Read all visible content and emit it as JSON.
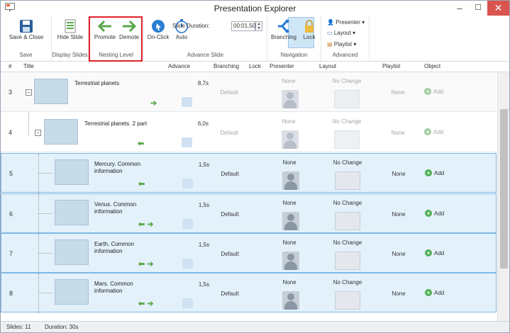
{
  "window": {
    "title": "Presentation Explorer",
    "controls": [
      "–",
      "☐",
      "✕"
    ]
  },
  "ribbon": {
    "save_close": "Save & Close",
    "save_group": "Save",
    "hide_slide": "Hide Slide",
    "display_group": "Display Slides",
    "promote": "Promote",
    "demote": "Demote",
    "nesting_group": "Nesting Level",
    "on_click": "On-Click",
    "auto": "Auto",
    "slide_duration_label": "Slide Duration:",
    "slide_duration_value": "00:01,50",
    "advance_group": "Advance Slide",
    "branching": "Branching",
    "lock": "Lock",
    "navigation_group": "Navigation",
    "presenter": "Presenter",
    "layout": "Layout",
    "playlist": "Playlist",
    "advanced_group": "Advanced"
  },
  "columns": {
    "num": "#",
    "title": "Title",
    "advance": "Advance",
    "branching": "Branching",
    "lock": "Lock",
    "presenter": "Presenter",
    "layout": "Layout",
    "playlist": "Playlist",
    "object": "Object"
  },
  "rows": [
    {
      "num": "3",
      "title": "Terrestrial planets",
      "advance": "8,7s",
      "branching": "Default",
      "presenter": "None",
      "layout": "No Change",
      "playlist": "None",
      "object": "Add",
      "arrows": "➔",
      "state": "gray"
    },
    {
      "num": "4",
      "title": "Terrestrial planets. 2 part",
      "advance": "6,0s",
      "branching": "Default",
      "presenter": "None",
      "layout": "No Change",
      "playlist": "None",
      "object": "Add",
      "arrows": "⬅",
      "state": "gray"
    },
    {
      "num": "5",
      "title": "Mercury. Common information",
      "advance": "1,5s",
      "branching": "Default",
      "presenter": "None",
      "layout": "No Change",
      "playlist": "None",
      "object": "Add",
      "arrows": "⬅",
      "state": "sel"
    },
    {
      "num": "6",
      "title": "Venus. Common information",
      "advance": "1,5s",
      "branching": "Default",
      "presenter": "None",
      "layout": "No Change",
      "playlist": "None",
      "object": "Add",
      "arrows": "⬅ ➔",
      "state": "sel"
    },
    {
      "num": "7",
      "title": "Earth. Common information",
      "advance": "1,5s",
      "branching": "Default",
      "presenter": "None",
      "layout": "No Change",
      "playlist": "None",
      "object": "Add",
      "arrows": "⬅ ➔",
      "state": "sel"
    },
    {
      "num": "8",
      "title": "Mars. Common information",
      "advance": "1,5s",
      "branching": "Default",
      "presenter": "None",
      "layout": "No Change",
      "playlist": "None",
      "object": "Add",
      "arrows": "⬅ ➔",
      "state": "sel"
    }
  ],
  "status": {
    "slides": "Slides: 11",
    "duration": "Duration: 30s"
  },
  "colors": {
    "accent": "#2b7cd3",
    "selected_row": "#e3f1fb",
    "highlight_box": "#e0222a",
    "arrow_green": "#5aa84b"
  }
}
